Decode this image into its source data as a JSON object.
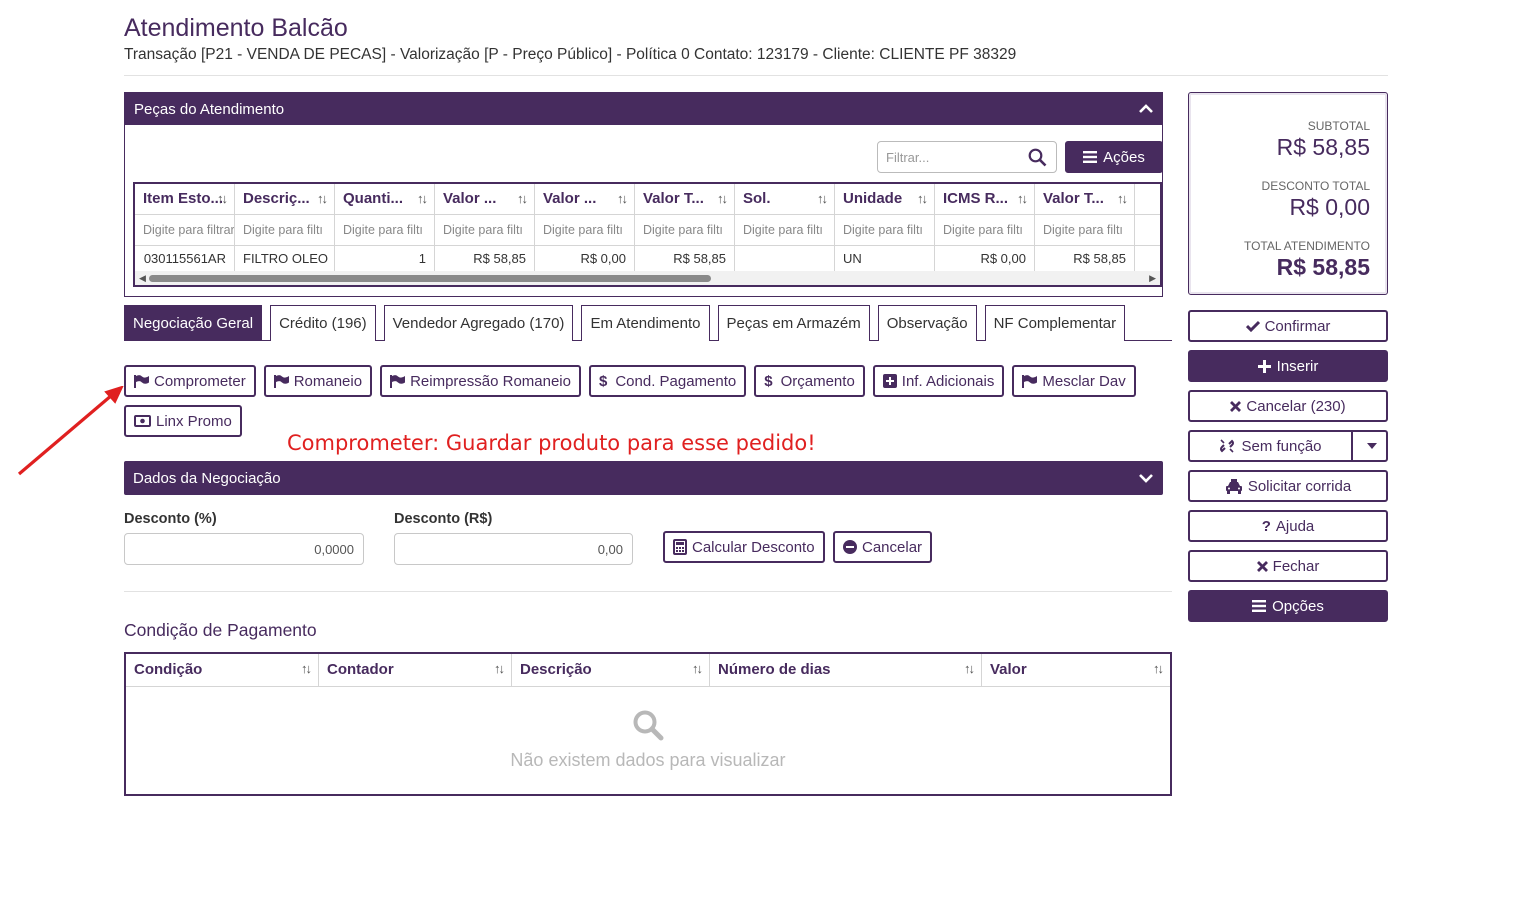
{
  "header": {
    "title": "Atendimento Balcão",
    "subtitle": "Transação [P21 - VENDA DE PECAS] - Valorização [P - Preço Público] - Política 0 Contato: 123179 - Cliente: CLIENTE PF 38329"
  },
  "pecas": {
    "title": "Peças do Atendimento",
    "filter_placeholder": "Filtrar...",
    "acoes_label": "Ações",
    "columns": [
      "Item Esto...",
      "Descriç...",
      "Quanti...",
      "Valor ...",
      "Valor ...",
      "Valor T...",
      "Sol.",
      "Unidade",
      "ICMS R...",
      "Valor T..."
    ],
    "filter_placeholders": [
      "Digite para filtrar...",
      "Digite para filtı",
      "Digite para filtı",
      "Digite para filtı",
      "Digite para filtı",
      "Digite para filtı",
      "Digite para filtı",
      "Digite para filtı",
      "Digite para filtı",
      "Digite para filtı"
    ],
    "rows": [
      [
        "030115561AR",
        "FILTRO OLEO",
        "1",
        "R$ 58,85",
        "R$ 0,00",
        "R$ 58,85",
        "",
        "UN",
        "R$ 0,00",
        "R$ 58,85"
      ]
    ]
  },
  "tabs": [
    "Negociação Geral",
    "Crédito (196)",
    "Vendedor Agregado (170)",
    "Em Atendimento",
    "Peças em Armazém",
    "Observação",
    "NF Complementar"
  ],
  "actions": {
    "comprometer": "Comprometer",
    "romaneio": "Romaneio",
    "reimpressao": "Reimpressão Romaneio",
    "cond_pagamento": "Cond. Pagamento",
    "orcamento": "Orçamento",
    "inf_adicionais": "Inf. Adicionais",
    "mesclar_dav": "Mesclar Dav",
    "linx_promo": "Linx Promo"
  },
  "annotation": "Comprometer: Guardar produto para esse pedido!",
  "negociacao": {
    "title": "Dados da Negociação",
    "desconto_pct_label": "Desconto (%)",
    "desconto_pct_value": "0,0000",
    "desconto_rs_label": "Desconto (R$)",
    "desconto_rs_value": "0,00",
    "calcular_label": "Calcular Desconto",
    "cancelar_label": "Cancelar"
  },
  "condicao": {
    "title": "Condição de Pagamento",
    "columns": [
      "Condição",
      "Contador",
      "Descrição",
      "Número de dias",
      "Valor"
    ],
    "empty": "Não existem dados para visualizar"
  },
  "summary": {
    "subtotal_label": "SUBTOTAL",
    "subtotal_value": "R$ 58,85",
    "desconto_label": "DESCONTO TOTAL",
    "desconto_value": "R$ 0,00",
    "total_label": "TOTAL ATENDIMENTO",
    "total_value": "R$ 58,85"
  },
  "sidebar": {
    "confirmar": "Confirmar",
    "inserir": "Inserir",
    "cancelar": "Cancelar (230)",
    "sem_funcao": "Sem função",
    "solicitar_corrida": "Solicitar corrida",
    "ajuda": "Ajuda",
    "fechar": "Fechar",
    "opcoes": "Opções"
  },
  "colors": {
    "primary": "#472b5e",
    "annotation": "#e02020"
  }
}
